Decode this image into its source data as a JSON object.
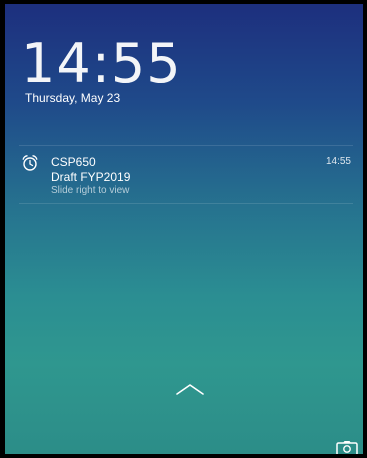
{
  "lockscreen": {
    "time": "14:55",
    "date": "Thursday, May 23"
  },
  "notification": {
    "icon": "alarm-clock-icon",
    "app": "CSP650",
    "title": "Draft FYP2019",
    "subtitle": "Slide right to view",
    "time": "14:55"
  },
  "controls": {
    "swipe_up_icon": "chevron-up-icon",
    "camera_icon": "camera-icon"
  }
}
